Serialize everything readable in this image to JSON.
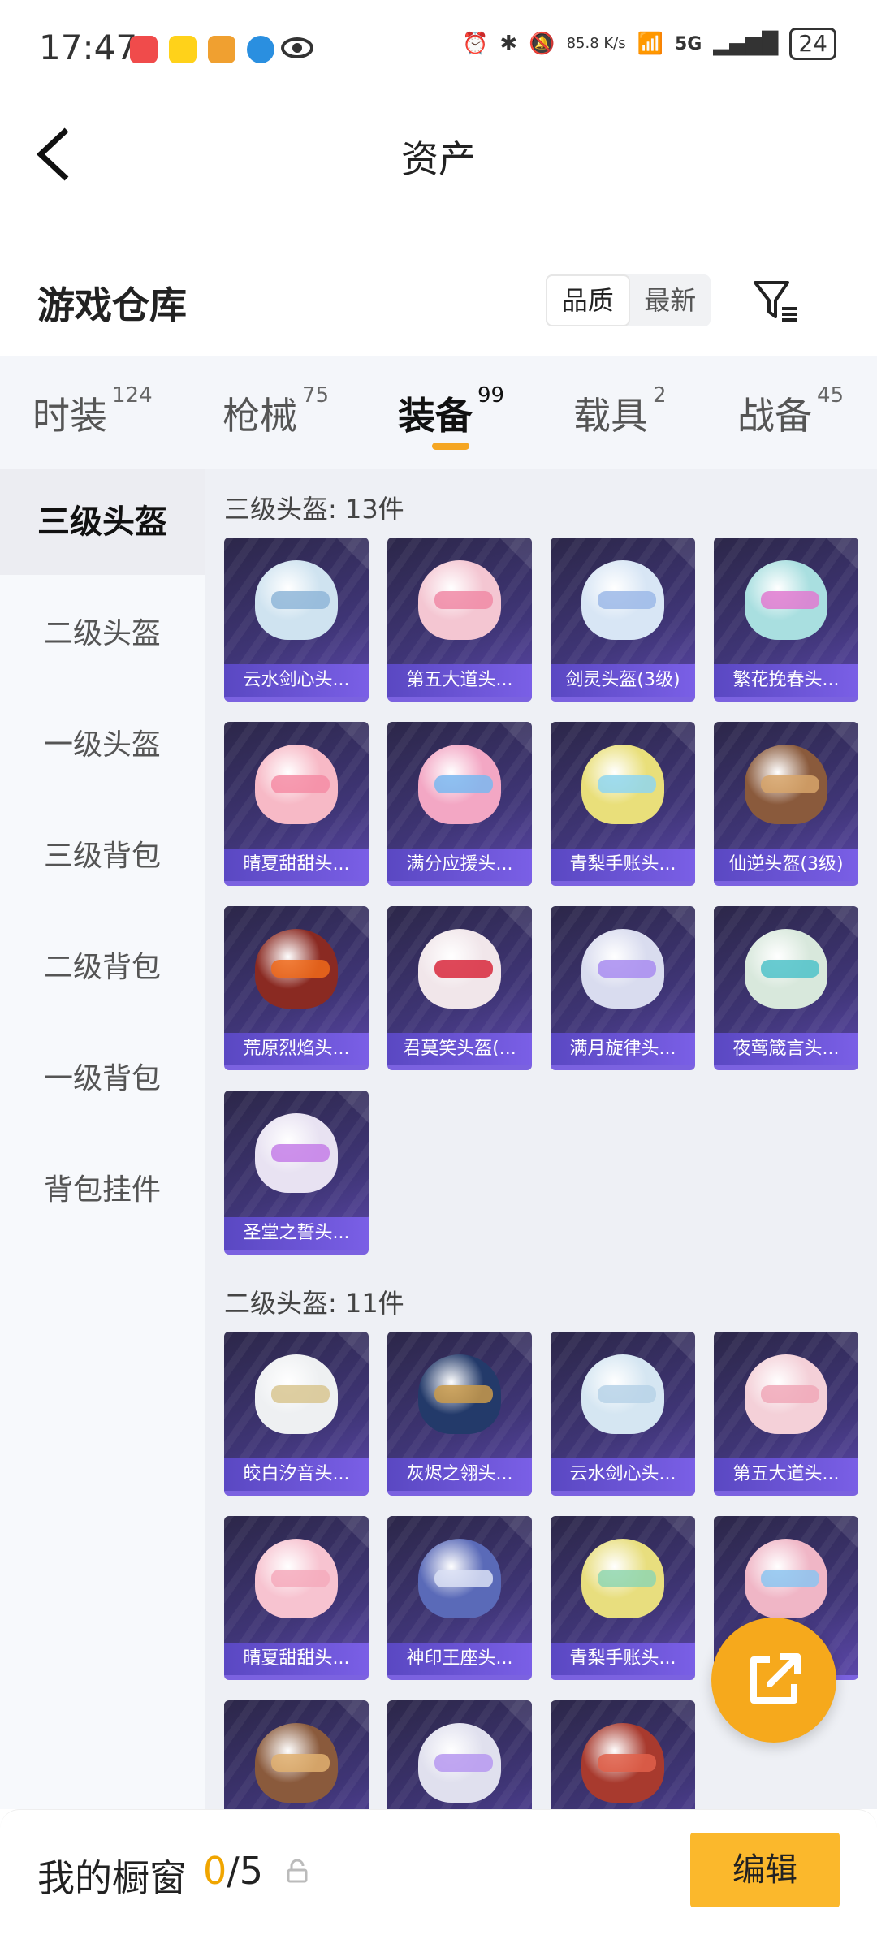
{
  "status_bar": {
    "time": "17:47",
    "network_speed": "85.8 K/s",
    "network_type": "5G",
    "battery": "24",
    "app_icons": [
      "red-app-icon",
      "yellow-app-icon",
      "orange-app-icon",
      "blue-app-icon",
      "eye-icon"
    ],
    "right_icons": [
      "alarm-icon",
      "bluetooth-icon",
      "mute-icon",
      "wifi-icon",
      "signal-icon",
      "battery-icon"
    ]
  },
  "header": {
    "title": "资产"
  },
  "warehouse": {
    "title": "游戏仓库",
    "sort_options": [
      "品质",
      "最新"
    ],
    "sort_active": "品质"
  },
  "tabs": [
    {
      "label": "时装",
      "count": "124"
    },
    {
      "label": "枪械",
      "count": "75"
    },
    {
      "label": "装备",
      "count": "99",
      "active": true
    },
    {
      "label": "载具",
      "count": "2"
    },
    {
      "label": "战备",
      "count": "45"
    }
  ],
  "sidebar": [
    {
      "label": "三级头盔",
      "active": true
    },
    {
      "label": "二级头盔"
    },
    {
      "label": "一级头盔"
    },
    {
      "label": "三级背包"
    },
    {
      "label": "二级背包"
    },
    {
      "label": "一级背包"
    },
    {
      "label": "背包挂件"
    }
  ],
  "sections": [
    {
      "title": "三级头盔: 13件",
      "items": [
        {
          "name": "云水剑心头...",
          "color": "#cfe3f0",
          "visor": "#8fb6d8"
        },
        {
          "name": "第五大道头...",
          "color": "#f4c6d2",
          "visor": "#f08aa6"
        },
        {
          "name": "剑灵头盔(3级)",
          "color": "#d8e6f5",
          "visor": "#9cb8e8"
        },
        {
          "name": "繁花挽春头...",
          "color": "#a9dfe0",
          "visor": "#e07ad0"
        },
        {
          "name": "晴夏甜甜头...",
          "color": "#f7b9c6",
          "visor": "#f58ca4"
        },
        {
          "name": "满分应援头...",
          "color": "#f3a7c4",
          "visor": "#7ab7f0"
        },
        {
          "name": "青梨手账头...",
          "color": "#e9df7a",
          "visor": "#8fd6ee"
        },
        {
          "name": "仙逆头盔(3级)",
          "color": "#8a5a3c",
          "visor": "#d7a56a"
        },
        {
          "name": "荒原烈焰头...",
          "color": "#8a2a22",
          "visor": "#f06a1a"
        },
        {
          "name": "君莫笑头盔(...",
          "color": "#f1e6ea",
          "visor": "#d8283c"
        },
        {
          "name": "满月旋律头...",
          "color": "#d9dcef",
          "visor": "#a88cf0"
        },
        {
          "name": "夜莺箴言头...",
          "color": "#d8e8dc",
          "visor": "#4fc2c9"
        },
        {
          "name": "圣堂之誓头...",
          "color": "#e8e2f2",
          "visor": "#c47ee8"
        }
      ]
    },
    {
      "title": "二级头盔: 11件",
      "items": [
        {
          "name": "皎白汐音头...",
          "color": "#eef0f2",
          "visor": "#d8c690"
        },
        {
          "name": "灰烬之翎头...",
          "color": "#233a6a",
          "visor": "#c99a4a"
        },
        {
          "name": "云水剑心头...",
          "color": "#d5e6f2",
          "visor": "#b7d2e8"
        },
        {
          "name": "第五大道头...",
          "color": "#f4d0d8",
          "visor": "#f0a8b8"
        },
        {
          "name": "晴夏甜甜头...",
          "color": "#f7c3d0",
          "visor": "#f4aabc"
        },
        {
          "name": "神印王座头...",
          "color": "#5a6ab8",
          "visor": "#dbe0f5"
        },
        {
          "name": "青梨手账头...",
          "color": "#e8de7e",
          "visor": "#8fd6b0"
        },
        {
          "name": "",
          "color": "#f0b6c6",
          "visor": "#8cc4f0"
        },
        {
          "name": "",
          "color": "#8a5a3c",
          "visor": "#e0b070"
        },
        {
          "name": "",
          "color": "#e0e0ee",
          "visor": "#b698f0"
        },
        {
          "name": "",
          "color": "#a83a2e",
          "visor": "#e0604a"
        }
      ]
    }
  ],
  "fab": {
    "icon": "share-icon"
  },
  "bottom_bar": {
    "label": "我的橱窗",
    "current": "0",
    "total": "/5",
    "edit_label": "编辑"
  }
}
